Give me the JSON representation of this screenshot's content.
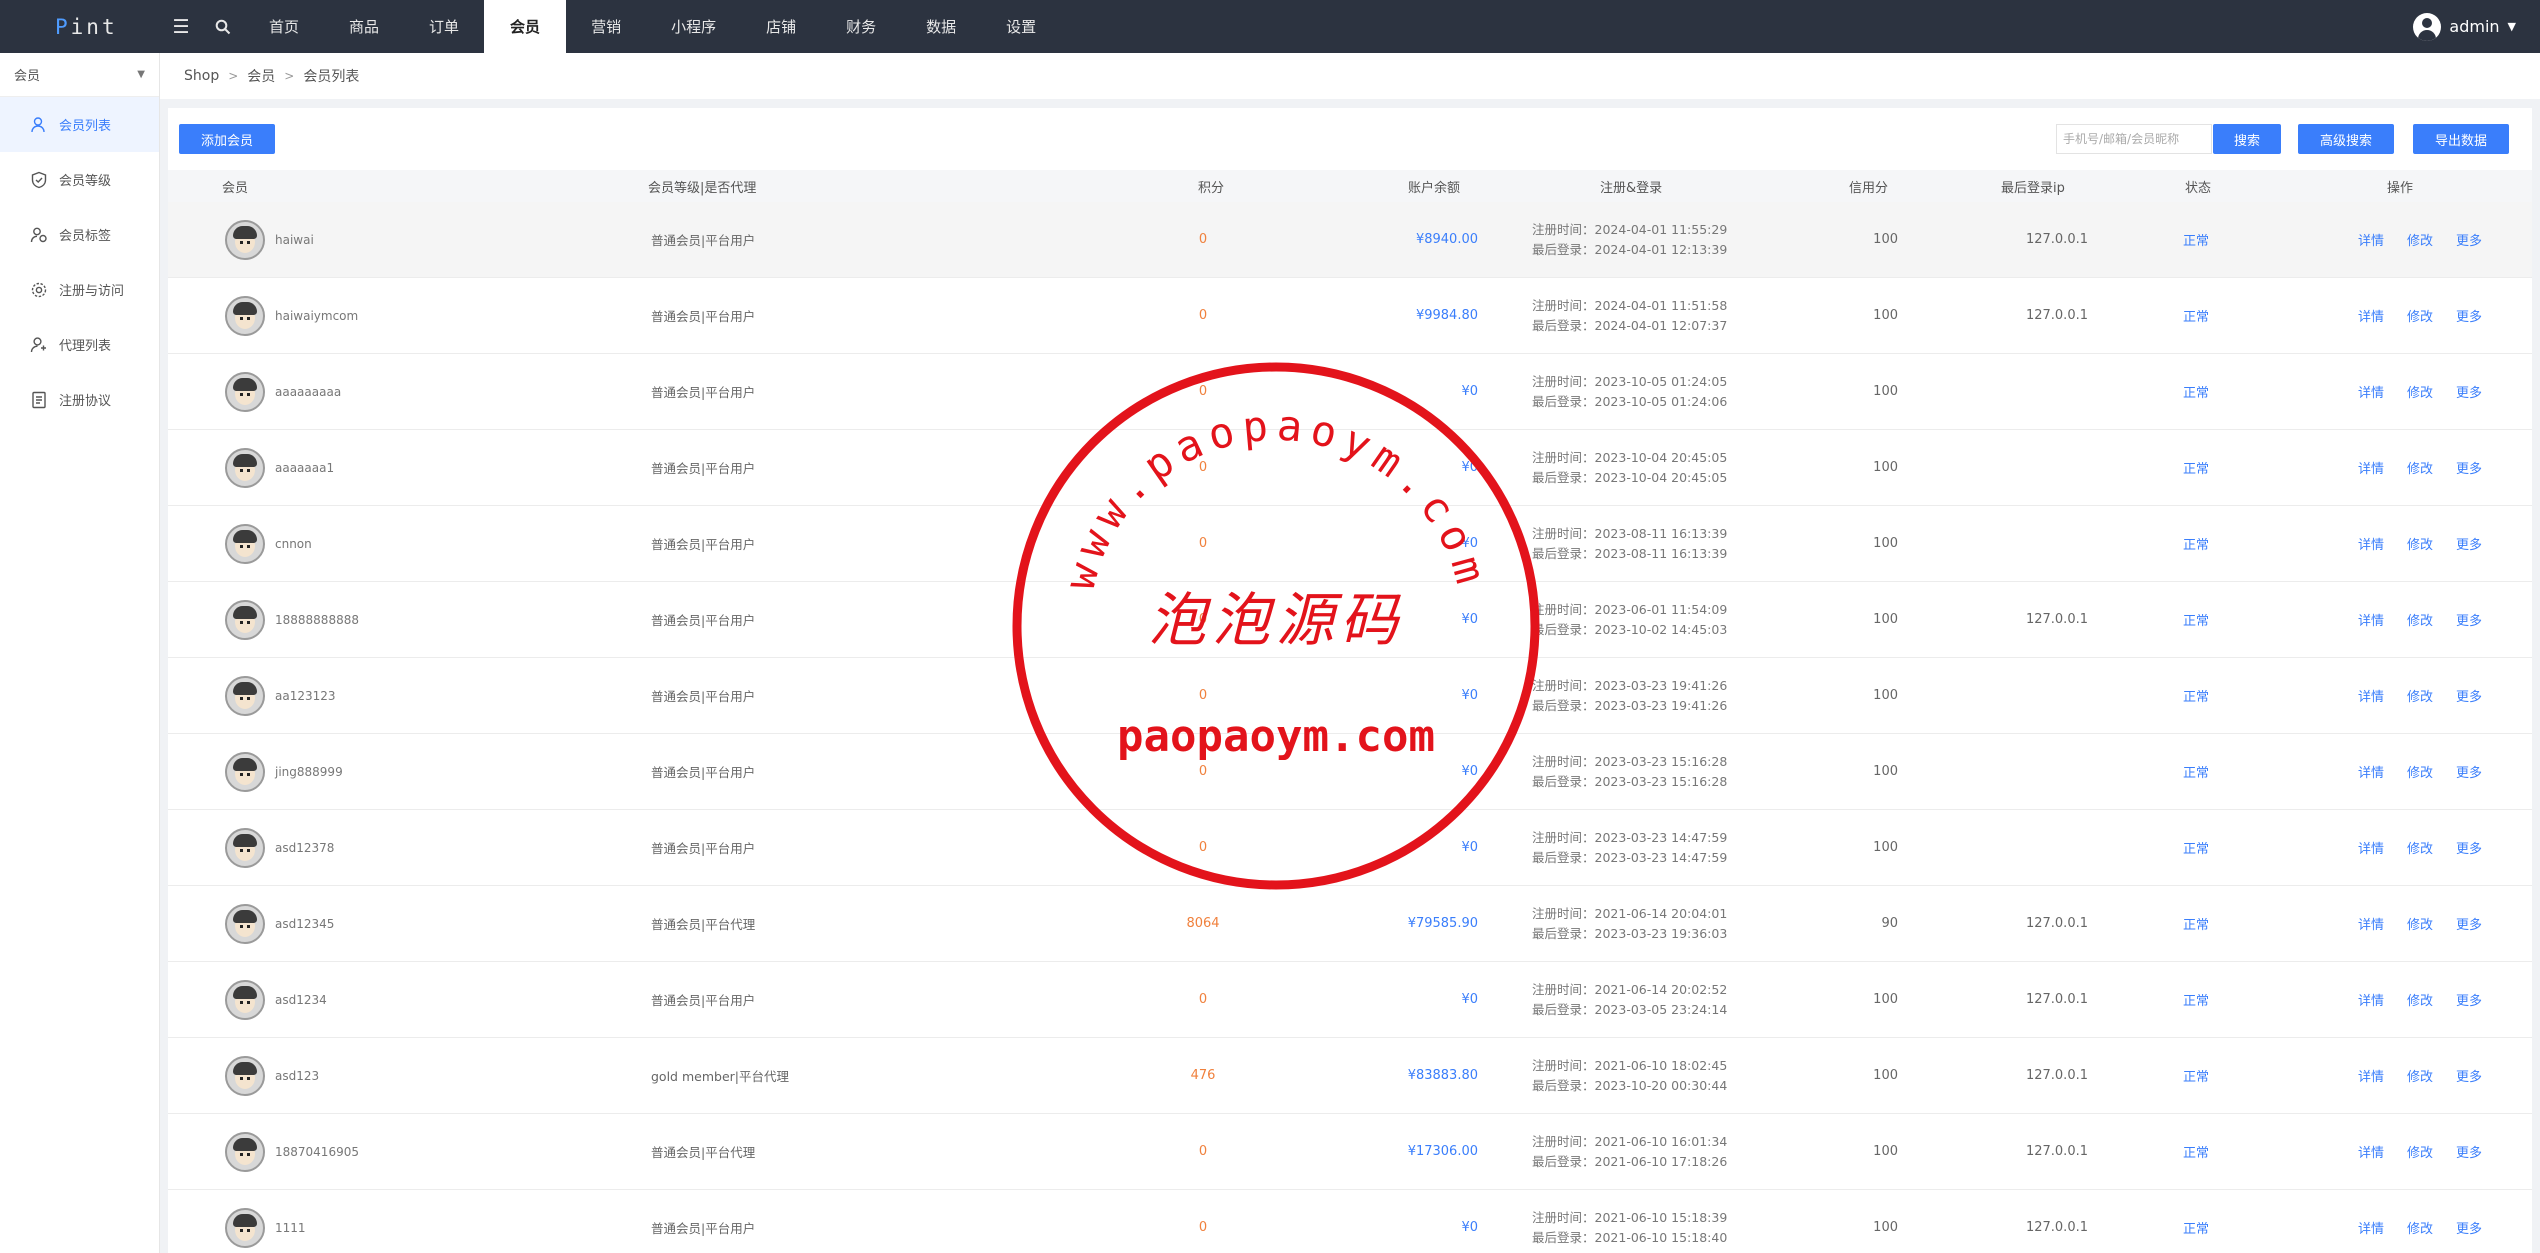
{
  "topbar": {
    "logo_first": "P",
    "logo_rest": "int",
    "nav": [
      "首页",
      "商品",
      "订单",
      "会员",
      "营销",
      "小程序",
      "店铺",
      "财务",
      "数据",
      "设置"
    ],
    "active_index": 3,
    "user": "admin"
  },
  "sidebar": {
    "header": "会员",
    "items": [
      {
        "label": "会员列表",
        "icon": "user-icon"
      },
      {
        "label": "会员等级",
        "icon": "shield-icon"
      },
      {
        "label": "会员标签",
        "icon": "user-tag-icon"
      },
      {
        "label": "注册与访问",
        "icon": "settings-icon"
      },
      {
        "label": "代理列表",
        "icon": "agent-user-icon"
      },
      {
        "label": "注册协议",
        "icon": "document-icon"
      }
    ],
    "active_index": 0
  },
  "breadcrumb": [
    "Shop",
    "会员",
    "会员列表"
  ],
  "toolbar": {
    "add_label": "添加会员",
    "search_placeholder": "手机号/邮箱/会员昵称",
    "search_label": "搜索",
    "advanced_label": "高级搜索",
    "export_label": "导出数据"
  },
  "table": {
    "headers": {
      "member": "会员",
      "level": "会员等级|是否代理",
      "points": "积分",
      "balance": "账户余额",
      "reg_login": "注册&登录",
      "credit": "信用分",
      "last_ip": "最后登录ip",
      "status": "状态",
      "actions": "操作"
    },
    "reg_prefix": "注册时间：",
    "login_prefix": "最后登录：",
    "action_labels": {
      "detail": "详情",
      "edit": "修改",
      "more": "更多"
    },
    "rows": [
      {
        "name": "haiwai",
        "level": "普通会员|平台用户",
        "points": "0",
        "balance": "¥8940.00",
        "reg": "2024-04-01 11:55:29",
        "login": "2024-04-01 12:13:39",
        "credit": "100",
        "ip": "127.0.0.1",
        "status": "正常"
      },
      {
        "name": "haiwaiymcom",
        "level": "普通会员|平台用户",
        "points": "0",
        "balance": "¥9984.80",
        "reg": "2024-04-01 11:51:58",
        "login": "2024-04-01 12:07:37",
        "credit": "100",
        "ip": "127.0.0.1",
        "status": "正常"
      },
      {
        "name": "aaaaaaaaa",
        "level": "普通会员|平台用户",
        "points": "0",
        "balance": "¥0",
        "reg": "2023-10-05 01:24:05",
        "login": "2023-10-05 01:24:06",
        "credit": "100",
        "ip": "",
        "status": "正常"
      },
      {
        "name": "aaaaaaa1",
        "level": "普通会员|平台用户",
        "points": "0",
        "balance": "¥0",
        "reg": "2023-10-04 20:45:05",
        "login": "2023-10-04 20:45:05",
        "credit": "100",
        "ip": "",
        "status": "正常"
      },
      {
        "name": "cnnon",
        "level": "普通会员|平台用户",
        "points": "0",
        "balance": "¥0",
        "reg": "2023-08-11 16:13:39",
        "login": "2023-08-11 16:13:39",
        "credit": "100",
        "ip": "",
        "status": "正常"
      },
      {
        "name": "18888888888",
        "level": "普通会员|平台用户",
        "points": "0",
        "balance": "¥0",
        "reg": "2023-06-01 11:54:09",
        "login": "2023-10-02 14:45:03",
        "credit": "100",
        "ip": "127.0.0.1",
        "status": "正常"
      },
      {
        "name": "aa123123",
        "level": "普通会员|平台用户",
        "points": "0",
        "balance": "¥0",
        "reg": "2023-03-23 19:41:26",
        "login": "2023-03-23 19:41:26",
        "credit": "100",
        "ip": "",
        "status": "正常"
      },
      {
        "name": "jing888999",
        "level": "普通会员|平台用户",
        "points": "0",
        "balance": "¥0",
        "reg": "2023-03-23 15:16:28",
        "login": "2023-03-23 15:16:28",
        "credit": "100",
        "ip": "",
        "status": "正常"
      },
      {
        "name": "asd12378",
        "level": "普通会员|平台用户",
        "points": "0",
        "balance": "¥0",
        "reg": "2023-03-23 14:47:59",
        "login": "2023-03-23 14:47:59",
        "credit": "100",
        "ip": "",
        "status": "正常"
      },
      {
        "name": "asd12345",
        "level": "普通会员|平台代理",
        "points": "8064",
        "balance": "¥79585.90",
        "reg": "2021-06-14 20:04:01",
        "login": "2023-03-23 19:36:03",
        "credit": "90",
        "ip": "127.0.0.1",
        "status": "正常"
      },
      {
        "name": "asd1234",
        "level": "普通会员|平台用户",
        "points": "0",
        "balance": "¥0",
        "reg": "2021-06-14 20:02:52",
        "login": "2023-03-05 23:24:14",
        "credit": "100",
        "ip": "127.0.0.1",
        "status": "正常"
      },
      {
        "name": "asd123",
        "level": "gold member|平台代理",
        "points": "476",
        "balance": "¥83883.80",
        "reg": "2021-06-10 18:02:45",
        "login": "2023-10-20 00:30:44",
        "credit": "100",
        "ip": "127.0.0.1",
        "status": "正常"
      },
      {
        "name": "18870416905",
        "level": "普通会员|平台代理",
        "points": "0",
        "balance": "¥17306.00",
        "reg": "2021-06-10 16:01:34",
        "login": "2021-06-10 17:18:26",
        "credit": "100",
        "ip": "127.0.0.1",
        "status": "正常"
      },
      {
        "name": "1111",
        "level": "普通会员|平台用户",
        "points": "0",
        "balance": "¥0",
        "reg": "2021-06-10 15:18:39",
        "login": "2021-06-10 15:18:40",
        "credit": "100",
        "ip": "127.0.0.1",
        "status": "正常"
      }
    ]
  },
  "watermark": {
    "arc_text": "www.paopaoym.com",
    "title": "泡泡源码",
    "bottom": "paopaoym.com",
    "color": "#e3131b"
  },
  "colors": {
    "topbar": "#2c3340",
    "accent": "#3a7efb",
    "points": "#f0803c"
  }
}
